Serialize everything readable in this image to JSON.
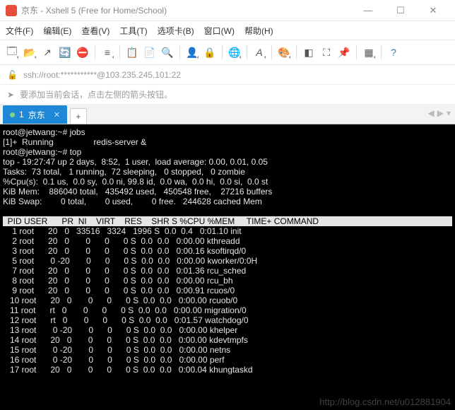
{
  "window": {
    "title": "京东 - Xshell 5 (Free for Home/School)"
  },
  "menu": {
    "file": "文件(F)",
    "edit": "编辑(E)",
    "view": "查看(V)",
    "tools": "工具(T)",
    "tabs": "选项卡(B)",
    "window": "窗口(W)",
    "help": "帮助(H)"
  },
  "address": {
    "url": "ssh://root:***********@103.235.245.101:22"
  },
  "tip": {
    "text": "要添加当前会话，点击左侧的箭头按钮。"
  },
  "tabs": {
    "tab1_index": "1",
    "tab1_label": "京东",
    "add": "+"
  },
  "term": {
    "l1": "root@jetwang:~# jobs",
    "l2": "[1]+  Running                 redis-server &",
    "l3": "root@jetwang:~# top",
    "l4": "top - 19:27:47 up 2 days,  8:52,  1 user,  load average: 0.00, 0.01, 0.05",
    "l5": "Tasks:  73 total,   1 running,  72 sleeping,   0 stopped,   0 zombie",
    "l6": "%Cpu(s):  0.1 us,  0.0 sy,  0.0 ni, 99.8 id,  0.0 wa,  0.0 hi,  0.0 si,  0.0 st",
    "l7": "KiB Mem:    886040 total,   435492 used,   450548 free,    27216 buffers",
    "l8": "KiB Swap:        0 total,        0 used,        0 free.   244628 cached Mem",
    "hdr": "  PID USER      PR  NI    VIRT    RES    SHR S %CPU %MEM     TIME+ COMMAND    ",
    "rows": [
      "    1 root      20   0   33516   3324   1996 S  0.0  0.4   0:01.10 init",
      "    2 root      20   0       0      0      0 S  0.0  0.0   0:00.00 kthreadd",
      "    3 root      20   0       0      0      0 S  0.0  0.0   0:00.16 ksoftirqd/0",
      "    5 root       0 -20       0      0      0 S  0.0  0.0   0:00.00 kworker/0:0H",
      "    7 root      20   0       0      0      0 S  0.0  0.0   0:01.36 rcu_sched",
      "    8 root      20   0       0      0      0 S  0.0  0.0   0:00.00 rcu_bh",
      "    9 root      20   0       0      0      0 S  0.0  0.0   0:00.91 rcuos/0",
      "   10 root      20   0       0      0      0 S  0.0  0.0   0:00.00 rcuob/0",
      "   11 root      rt   0       0      0      0 S  0.0  0.0   0:00.00 migration/0",
      "   12 root      rt   0       0      0      0 S  0.0  0.0   0:01.57 watchdog/0",
      "   13 root       0 -20       0      0      0 S  0.0  0.0   0:00.00 khelper",
      "   14 root      20   0       0      0      0 S  0.0  0.0   0:00.00 kdevtmpfs",
      "   15 root       0 -20       0      0      0 S  0.0  0.0   0:00.00 netns",
      "   16 root       0 -20       0      0      0 S  0.0  0.0   0:00.00 perf",
      "   17 root      20   0       0      0      0 S  0.0  0.0   0:00.04 khungtaskd"
    ]
  },
  "watermark": "http://blog.csdn.net/u012881904"
}
